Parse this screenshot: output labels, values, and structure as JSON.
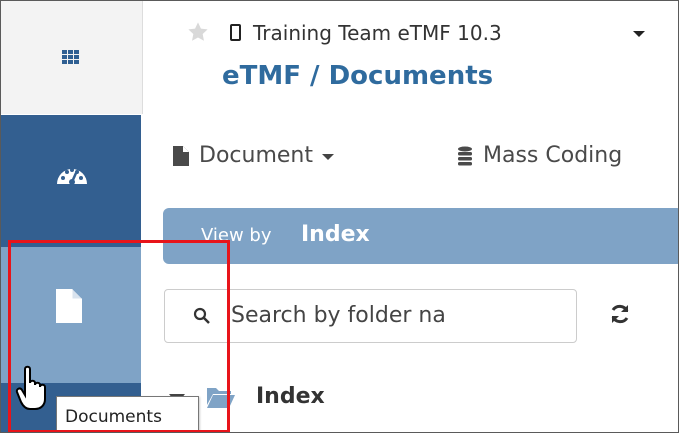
{
  "header": {
    "study_title": "Training Team eTMF 10.3",
    "page_title": "eTMF / Documents",
    "icons": [
      "apps-grid-icon",
      "star-icon",
      "mobile-phone-icon",
      "caret-down-icon"
    ]
  },
  "sidenav": {
    "items": [
      {
        "name": "dashboard",
        "icon": "tachometer-icon"
      },
      {
        "name": "documents",
        "icon": "file-icon",
        "active": true
      }
    ],
    "tooltip": "Documents"
  },
  "toolbar": {
    "document_label": "Document",
    "mass_coding_label": "Mass Coding"
  },
  "viewby": {
    "label": "View by",
    "value": "Index"
  },
  "search": {
    "placeholder": "Search by folder na"
  },
  "tree": {
    "root_label": "Index"
  },
  "colors": {
    "nav_dark": "#335f90",
    "nav_active": "#7fa3c6",
    "title_blue": "#2f6b9e",
    "highlight_red": "#e8141a"
  }
}
